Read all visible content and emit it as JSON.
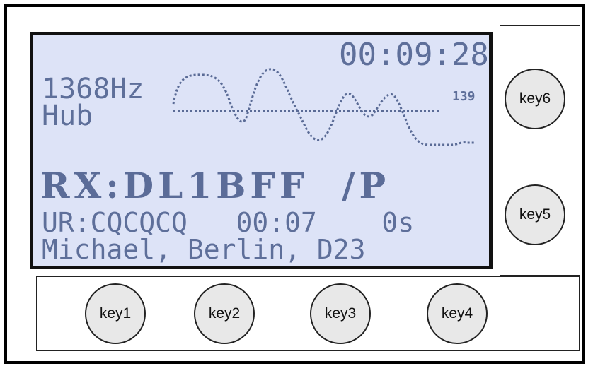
{
  "display": {
    "time": "00:09:28",
    "frequency": "1368Hz",
    "mode": "Hub",
    "level": "139",
    "rx_callsign": "RX:DL1BFF  /P",
    "ur_line": "UR:CQCQCQ   00:07    0s",
    "message": "Michael, Berlin, D23"
  },
  "keys": {
    "key1": "key1",
    "key2": "key2",
    "key3": "key3",
    "key4": "key4",
    "key5": "key5",
    "key6": "key6"
  },
  "colors": {
    "lcd_background": "#dde3f7",
    "lcd_text": "#5e6f9a",
    "bezel": "#111111"
  }
}
